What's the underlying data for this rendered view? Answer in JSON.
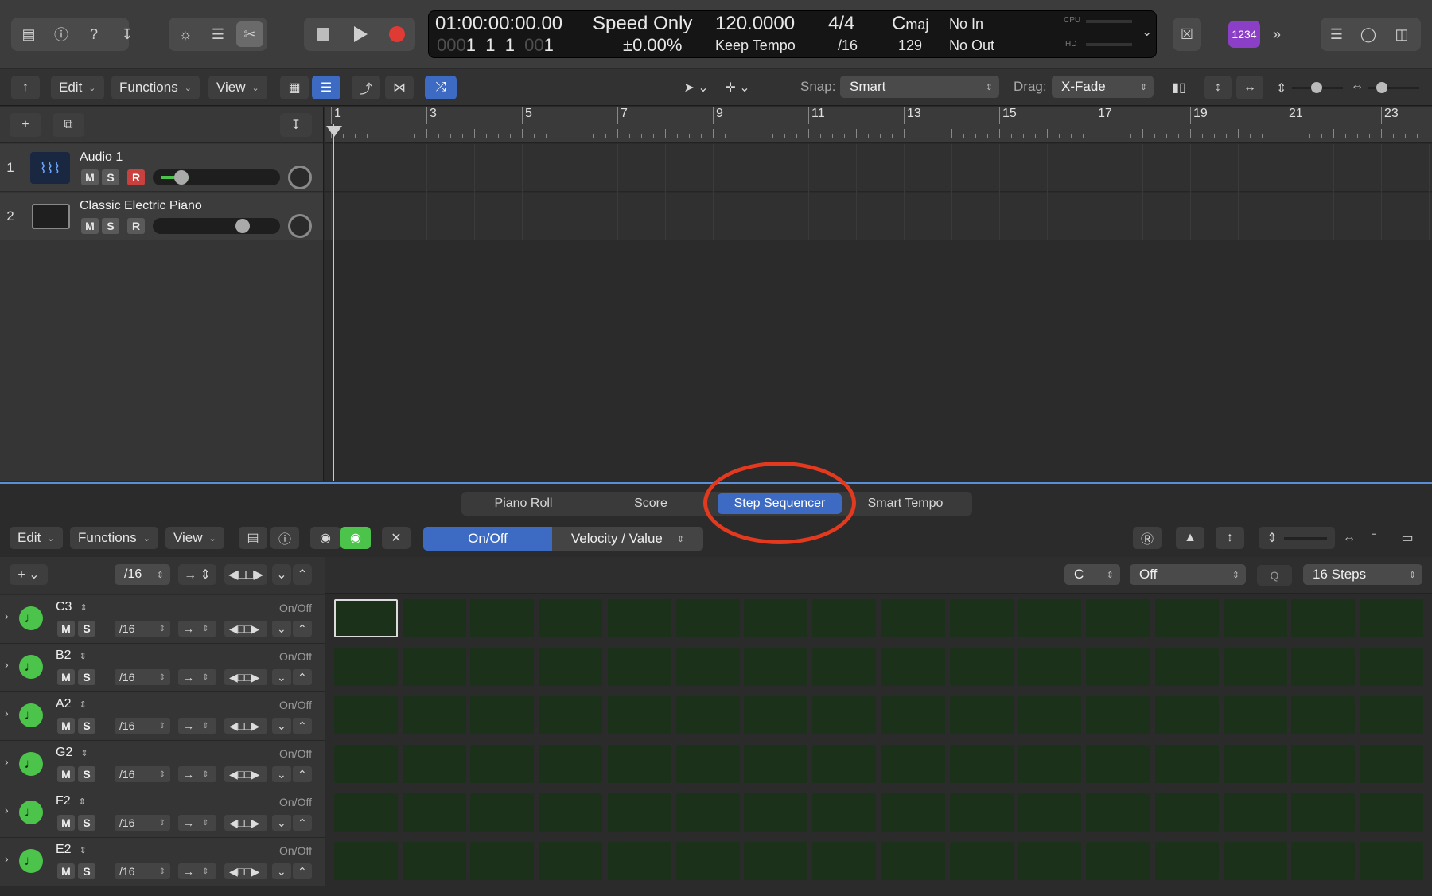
{
  "titlebar": {
    "lcd": {
      "timecode": "01:00:00:00.00",
      "position_dim_a": "000",
      "position_1": "1",
      "position_2": "1",
      "position_3": "1",
      "position_dim_b": "00",
      "position_4": "1",
      "mode": "Speed Only",
      "speed": "±0.00",
      "speed_unit": "%",
      "tempo": "120.0000",
      "tempo_mode": "Keep Tempo",
      "signature": "4/4",
      "division": "/16",
      "key_root": "C",
      "key_mode": "maj",
      "key_number": "129",
      "midi_in": "No In",
      "midi_out": "No Out",
      "cpu_label": "CPU",
      "hd_label": "HD"
    },
    "badge": "1234"
  },
  "toolbar": {
    "edit": "Edit",
    "functions": "Functions",
    "view": "View",
    "snap_label": "Snap:",
    "snap_value": "Smart",
    "drag_label": "Drag:",
    "drag_value": "X-Fade"
  },
  "tracks": [
    {
      "number": "1",
      "name": "Audio 1",
      "m": "M",
      "s": "S",
      "r": "R"
    },
    {
      "number": "2",
      "name": "Classic Electric Piano",
      "m": "M",
      "s": "S",
      "r": "R"
    }
  ],
  "ruler": [
    "1",
    "3",
    "5",
    "7",
    "9",
    "11",
    "13",
    "15",
    "17",
    "19",
    "21",
    "23"
  ],
  "editor": {
    "tabs": [
      "Piano Roll",
      "Score",
      "Step Sequencer",
      "Smart Tempo"
    ],
    "active_tab": "Step Sequencer",
    "menus": {
      "edit": "Edit",
      "functions": "Functions",
      "view": "View"
    },
    "mode_onoff": "On/Off",
    "mode_velocity": "Velocity / Value",
    "global": {
      "rate": "/16",
      "key": "C",
      "scale": "Off",
      "q": "Q",
      "steps": "16 Steps"
    },
    "rows": [
      {
        "pitch": "C3",
        "mode": "On/Off",
        "m": "M",
        "s": "S",
        "rate": "/16"
      },
      {
        "pitch": "B2",
        "mode": "On/Off",
        "m": "M",
        "s": "S",
        "rate": "/16"
      },
      {
        "pitch": "A2",
        "mode": "On/Off",
        "m": "M",
        "s": "S",
        "rate": "/16"
      },
      {
        "pitch": "G2",
        "mode": "On/Off",
        "m": "M",
        "s": "S",
        "rate": "/16"
      },
      {
        "pitch": "F2",
        "mode": "On/Off",
        "m": "M",
        "s": "S",
        "rate": "/16"
      },
      {
        "pitch": "E2",
        "mode": "On/Off",
        "m": "M",
        "s": "S",
        "rate": "/16"
      }
    ]
  },
  "colors": {
    "accent": "#3d6bc4",
    "record": "#c8413e",
    "step_cell": "#1b3119",
    "note_green": "#4cc34a",
    "annotation": "#e2391f",
    "badge": "#8b3fc7"
  }
}
